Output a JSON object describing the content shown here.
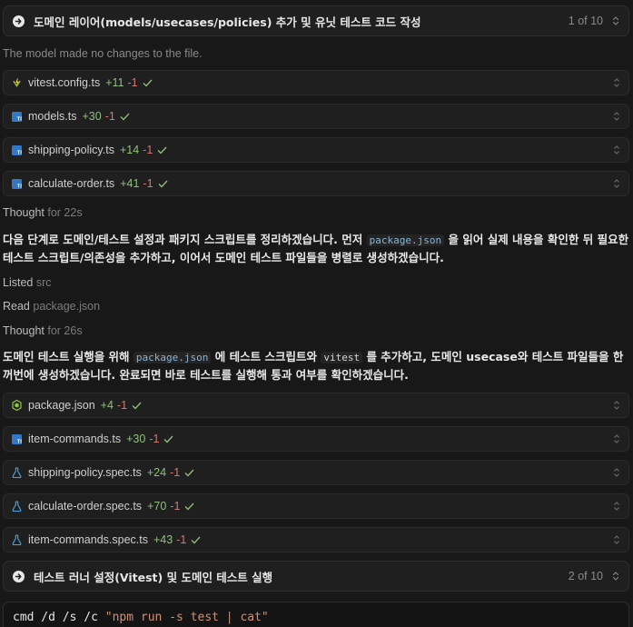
{
  "step1": {
    "title": "도메인 레이어(models/usecases/policies) 추가 및 유닛 테스트 코드 작성",
    "counter": "1 of 10"
  },
  "no_change_note": "The model made no changes to the file.",
  "files_group1": [
    {
      "name": "vitest.config.ts",
      "added": "+11",
      "removed": "-1",
      "icon": "vitest-icon"
    },
    {
      "name": "models.ts",
      "added": "+30",
      "removed": "-1",
      "icon": "typescript-icon"
    },
    {
      "name": "shipping-policy.ts",
      "added": "+14",
      "removed": "-1",
      "icon": "typescript-icon"
    },
    {
      "name": "calculate-order.ts",
      "added": "+41",
      "removed": "-1",
      "icon": "typescript-icon"
    }
  ],
  "thought1": {
    "label": "Thought",
    "value": "for 22s"
  },
  "para1": {
    "before": "다음 단계로 도메인/테스트 설정과 패키지 스크립트를 정리하겠습니다. 먼저",
    "code": "package.json",
    "after": "을 읽어 실제 내용을 확인한 뒤 필요한 테스트 스크립트/의존성을 추가하고, 이어서 도메인 테스트 파일들을 병렬로 생성하겠습니다."
  },
  "listed": {
    "label": "Listed",
    "value": "src"
  },
  "read": {
    "label": "Read",
    "value": "package.json"
  },
  "thought2": {
    "label": "Thought",
    "value": "for 26s"
  },
  "para2": {
    "part1": "도메인 테스트 실행을 위해",
    "code1": "package.json",
    "part2": "에 테스트 스크립트와",
    "code2": "vitest",
    "part3": "를 추가하고, 도메인 usecase와 테스트 파일들을 한꺼번에 생성하겠습니다. 완료되면 바로 테스트를 실행해 통과 여부를 확인하겠습니다."
  },
  "files_group2": [
    {
      "name": "package.json",
      "added": "+4",
      "removed": "-1",
      "icon": "nodejs-icon"
    },
    {
      "name": "item-commands.ts",
      "added": "+30",
      "removed": "-1",
      "icon": "typescript-icon"
    },
    {
      "name": "shipping-policy.spec.ts",
      "added": "+24",
      "removed": "-1",
      "icon": "flask-icon"
    },
    {
      "name": "calculate-order.spec.ts",
      "added": "+70",
      "removed": "-1",
      "icon": "flask-icon"
    },
    {
      "name": "item-commands.spec.ts",
      "added": "+43",
      "removed": "-1",
      "icon": "flask-icon"
    }
  ],
  "step2": {
    "title": "테스트 러너 설정(Vitest) 및 도메인 테스트 실행",
    "counter": "2 of 10"
  },
  "command": {
    "prefix": "cmd /d /s /c",
    "arg": "\"npm run -s test | cat\""
  },
  "colors": {
    "added": "#8fc07a",
    "removed": "#d27a6f",
    "ts_blue": "#3178c6",
    "vitest_yellow": "#fcc72b",
    "node_green": "#8cc84b",
    "flask_blue": "#4fa3e0"
  }
}
